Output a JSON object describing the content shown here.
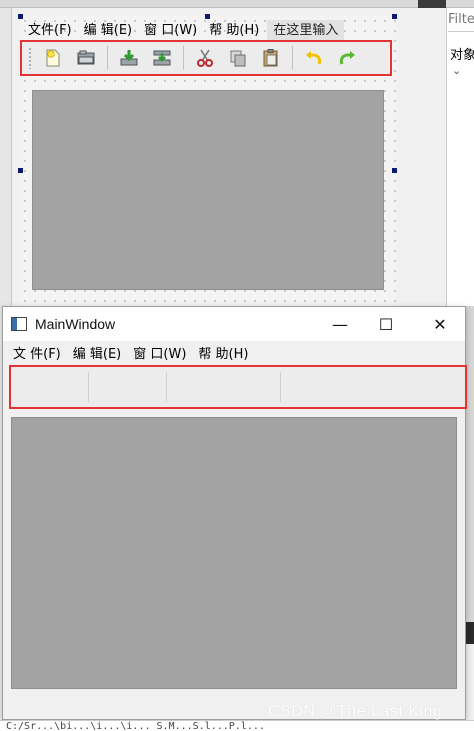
{
  "designer": {
    "menus": [
      "文件(F)",
      "编 辑(E)",
      "窗 口(W)",
      "帮 助(H)"
    ],
    "type_here": "在这里输入",
    "toolbar_icons": [
      "new-file-icon",
      "open-folder-icon",
      "save-icon",
      "save-as-icon",
      "cut-icon",
      "copy-icon",
      "paste-icon",
      "undo-icon",
      "redo-icon"
    ]
  },
  "side_panel": {
    "filter_placeholder": "Filter",
    "object_label": "对象",
    "chevron": "⌄"
  },
  "preview": {
    "title": "MainWindow",
    "minimize": "—",
    "maximize": "☐",
    "close": "✕",
    "menus": [
      "文 件(F)",
      "编 辑(E)",
      "窗 口(W)",
      "帮 助(H)"
    ]
  },
  "footer": {
    "path_text": "C:/Sr...\\bi...\\i...\\i...          S.M...S.l...P.l...",
    "watermark": "CSDN @The   Last   King"
  },
  "colors": {
    "highlight_border": "#e53333",
    "central_widget": "#a3a3a3",
    "handle": "#0a1a6e"
  }
}
